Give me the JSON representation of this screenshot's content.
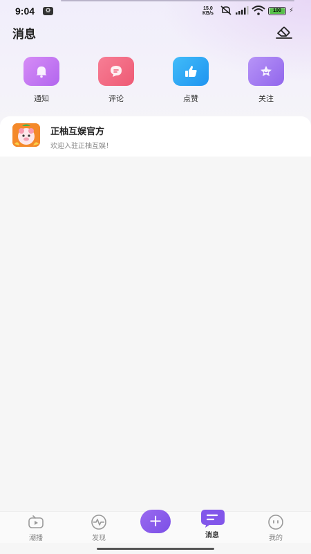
{
  "status_bar": {
    "time": "9:04",
    "network_speed_value": "15.0",
    "network_speed_unit": "KB/s",
    "battery": "100"
  },
  "header": {
    "title": "消息",
    "clear_icon": "eraser-icon"
  },
  "quick_actions": [
    {
      "label": "通知",
      "icon": "bell-icon",
      "color": "#c778f2"
    },
    {
      "label": "评论",
      "icon": "comment-bubble-icon",
      "color": "#f26b85"
    },
    {
      "label": "点赞",
      "icon": "thumbs-up-icon",
      "color": "#2ea8f5"
    },
    {
      "label": "关注",
      "icon": "star-icon",
      "color": "#a37bf0"
    }
  ],
  "messages": [
    {
      "title": "正柚互娱官方",
      "preview": "欢迎入驻正柚互娱！",
      "avatar": "app-logo-avatar"
    }
  ],
  "tabbar": {
    "items": [
      {
        "label": "潮播",
        "icon": "tv-play-icon"
      },
      {
        "label": "发现",
        "icon": "pulse-icon"
      },
      {
        "label": "消息",
        "icon": "chat-bubble-icon"
      },
      {
        "label": "我的",
        "icon": "smiley-face-icon"
      }
    ],
    "publish_label": "+",
    "active": "消息",
    "accent": "#8256ea"
  }
}
